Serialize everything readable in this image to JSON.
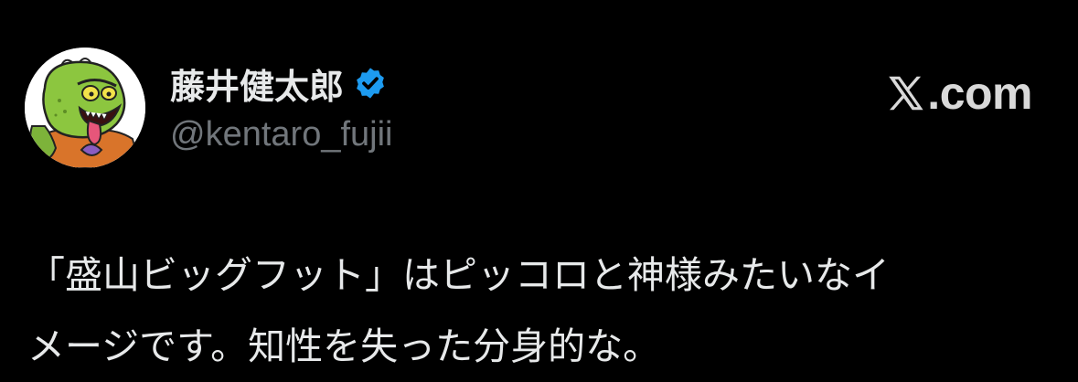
{
  "author": {
    "display_name": "藤井健太郎",
    "handle": "@kentaro_fujii",
    "verified": true,
    "avatar_icon": "green-monster-avatar-icon"
  },
  "brand": {
    "label": ".com",
    "logo_icon": "x-logo-icon"
  },
  "tweet": {
    "lines": [
      "「盛山ビッグフット」はピッコロと神様みたいなイ",
      "メージです。知性を失った分身的な。"
    ]
  },
  "colors": {
    "background": "#000000",
    "text": "#e7e9ea",
    "handle": "#71767b",
    "verified_blue": "#1d9bf0",
    "brand": "#d9d9d9"
  }
}
